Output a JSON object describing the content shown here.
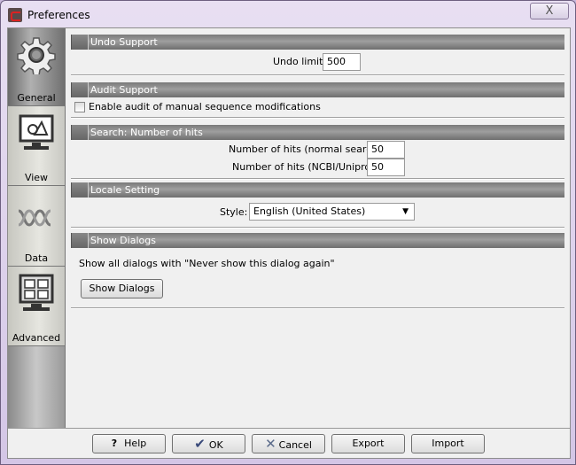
{
  "window": {
    "title": "Preferences",
    "close_label": "X"
  },
  "sidebar": {
    "items": [
      {
        "label": "General",
        "icon": "gear-icon",
        "selected": true
      },
      {
        "label": "View",
        "icon": "monitor-shapes-icon"
      },
      {
        "label": "Data",
        "icon": "dna-icon"
      },
      {
        "label": "Advanced",
        "icon": "monitor-checklist-icon"
      }
    ]
  },
  "sections": {
    "undo": {
      "title": "Undo Support",
      "limit_label": "Undo limit:",
      "limit_value": "500"
    },
    "audit": {
      "title": "Audit Support",
      "checkbox_label": "Enable audit of manual sequence modifications",
      "checked": false
    },
    "search": {
      "title": "Search: Number of hits",
      "normal_label": "Number of hits (normal search):",
      "normal_value": "50",
      "ncbi_label": "Number of hits (NCBI/Uniprot):",
      "ncbi_value": "50"
    },
    "locale": {
      "title": "Locale Setting",
      "style_label": "Style:",
      "style_value": "English (United States)"
    },
    "dialogs": {
      "title": "Show Dialogs",
      "text": "Show all dialogs with \"Never show this dialog again\"",
      "button": "Show Dialogs"
    }
  },
  "footer": {
    "help": "Help",
    "ok": "OK",
    "cancel": "Cancel",
    "export": "Export",
    "import": "Import"
  }
}
